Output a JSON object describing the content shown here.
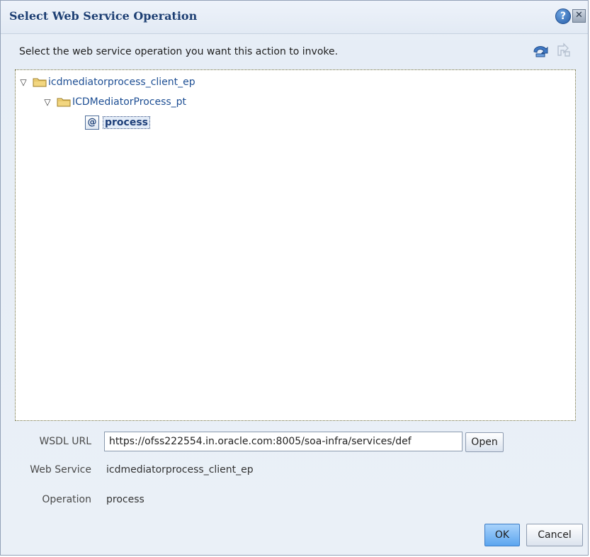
{
  "dialog": {
    "title": "Select Web Service Operation",
    "help_glyph": "?",
    "close_glyph": "✕"
  },
  "instruction": "Select the web service operation you want this action to invoke.",
  "tree": {
    "root_label": "icdmediatorprocess_client_ep",
    "port_label": "ICDMediatorProcess_pt",
    "operation_label": "process",
    "expanded_glyph": "▽",
    "operation_icon_glyph": "@"
  },
  "fields": {
    "wsdl_url_label": "WSDL URL",
    "wsdl_url_value": "https://ofss222554.in.oracle.com:8005/soa-infra/services/def",
    "open_label": "Open",
    "web_service_label": "Web Service",
    "web_service_value": "icdmediatorprocess_client_ep",
    "operation_label": "Operation",
    "operation_value": "process"
  },
  "buttons": {
    "ok": "OK",
    "cancel": "Cancel"
  },
  "icons": {
    "help": "help-icon",
    "close": "close-icon",
    "undo": "undo-icon",
    "redo": "redo-icon",
    "folder": "folder-icon",
    "operation": "operation-icon"
  },
  "colors": {
    "title": "#1d3f73",
    "link": "#1e4f94",
    "ok_button": "#5ba5ef"
  }
}
